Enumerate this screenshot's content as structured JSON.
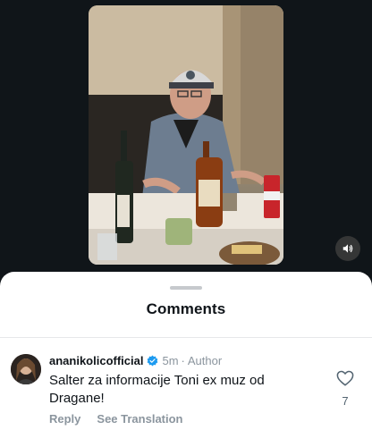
{
  "sheet": {
    "title": "Comments"
  },
  "comment": {
    "author": "ananikolicofficial",
    "verified": true,
    "time": "5m",
    "separator": "·",
    "role": "Author",
    "text": "Salter za informacije Toni ex muz od Dragane!",
    "reply_label": "Reply",
    "translate_label": "See Translation",
    "like_count": "7"
  },
  "colors": {
    "sheet_background": "#ffffff",
    "page_background": "#0f1419",
    "verified_blue": "#1d9bf0",
    "muted_text": "#8b959e"
  },
  "icons": {
    "volume": "speaker-icon",
    "verified": "verified-badge-icon",
    "like": "heart-outline-icon"
  }
}
